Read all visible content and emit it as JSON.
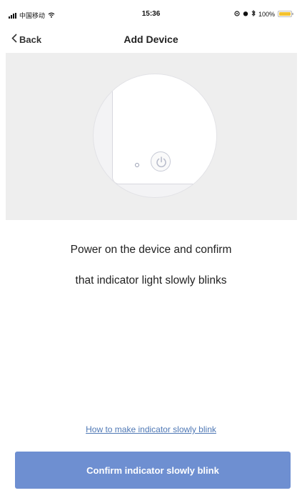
{
  "status_bar": {
    "carrier": "中国移动",
    "time": "15:36",
    "battery": "100%",
    "battery_level": 1.0,
    "battery_color": "#f3c22f"
  },
  "nav": {
    "back_label": "Back",
    "title": "Add Device"
  },
  "illustration": {
    "device_icon": "power-icon"
  },
  "instruction": {
    "line1": "Power on the device and confirm",
    "line2": "that indicator light slowly blinks"
  },
  "help_link": "How to make indicator slowly blink",
  "confirm_button": {
    "label": "Confirm indicator slowly blink",
    "color": "#6e8fd1"
  }
}
